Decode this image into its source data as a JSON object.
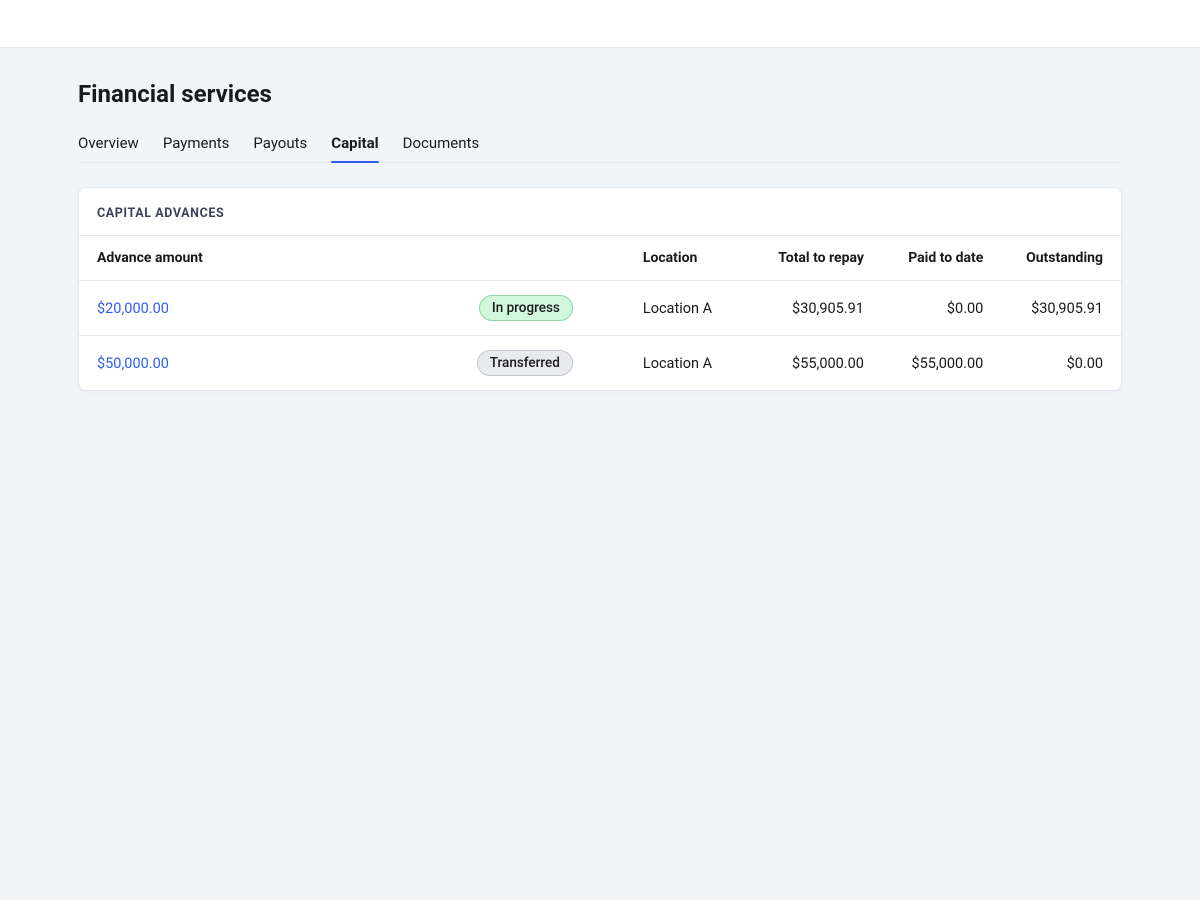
{
  "page": {
    "title": "Financial services"
  },
  "tabs": [
    {
      "label": "Overview",
      "active": false
    },
    {
      "label": "Payments",
      "active": false
    },
    {
      "label": "Payouts",
      "active": false
    },
    {
      "label": "Capital",
      "active": true
    },
    {
      "label": "Documents",
      "active": false
    }
  ],
  "card": {
    "header": "CAPITAL ADVANCES",
    "columns": {
      "amount": "Advance amount",
      "location": "Location",
      "total": "Total to repay",
      "paid": "Paid to date",
      "outstanding": "Outstanding"
    },
    "rows": [
      {
        "amount": "$20,000.00",
        "status": "In progress",
        "status_kind": "green",
        "location": "Location A",
        "total": "$30,905.91",
        "paid": "$0.00",
        "outstanding": "$30,905.91"
      },
      {
        "amount": "$50,000.00",
        "status": "Transferred",
        "status_kind": "gray",
        "location": "Location A",
        "total": "$55,000.00",
        "paid": "$55,000.00",
        "outstanding": "$0.00"
      }
    ]
  }
}
